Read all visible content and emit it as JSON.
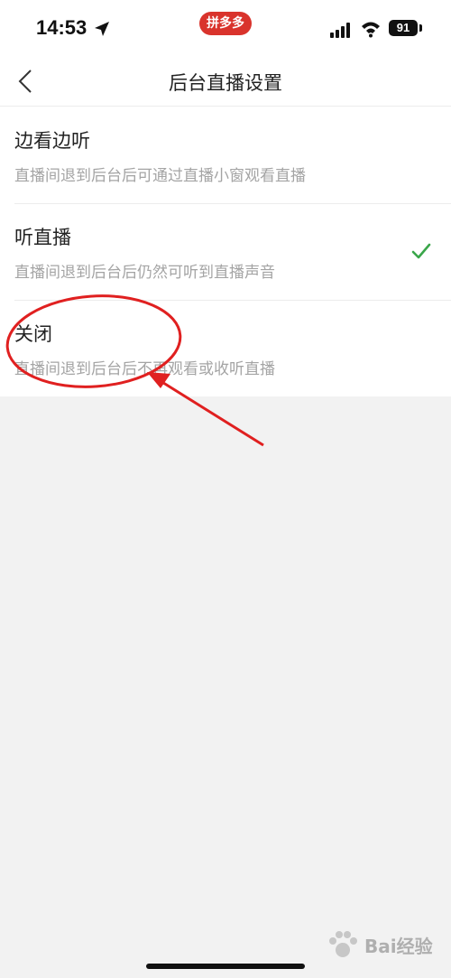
{
  "status_bar": {
    "time": "14:53",
    "center_pill": "拼多多",
    "battery": "91",
    "icons": [
      "location-icon",
      "signal-icon",
      "wifi-icon",
      "battery-icon"
    ]
  },
  "nav": {
    "title": "后台直播设置",
    "back_icon": "back-chevron-icon"
  },
  "options": [
    {
      "title": "边看边听",
      "desc": "直播间退到后台后可通过直播小窗观看直播",
      "selected": false
    },
    {
      "title": "听直播",
      "desc": "直播间退到后台后仍然可听到直播声音",
      "selected": true
    },
    {
      "title": "关闭",
      "desc": "直播间退到后台后不再观看或收听直播",
      "selected": false
    }
  ],
  "colors": {
    "accent_check": "#3aa64a",
    "annotation_red": "#e02020",
    "pill_red": "#d9332c"
  },
  "watermark": {
    "text": "Bai经验"
  }
}
